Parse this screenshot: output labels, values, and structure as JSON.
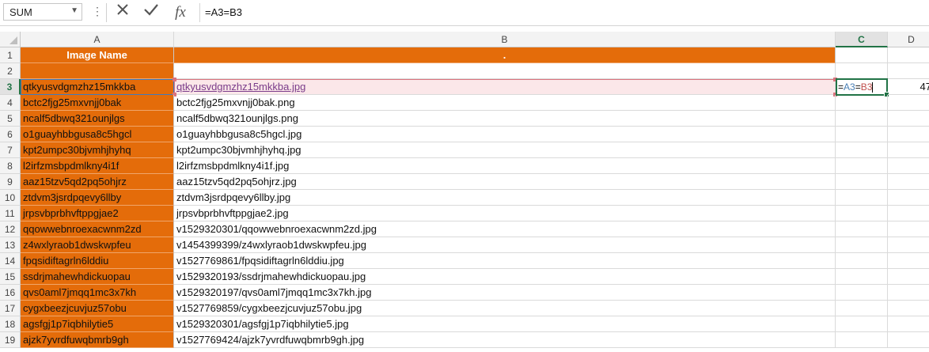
{
  "formula_bar": {
    "name_box": "SUM",
    "formula": "=A3=B3",
    "cancel_icon": "x-icon",
    "enter_icon": "check-icon",
    "function_label": "fx"
  },
  "columns": [
    "A",
    "B",
    "C",
    "D"
  ],
  "selected_column": "C",
  "selected_row": "3",
  "rows": [
    {
      "num": "1",
      "a": "Image Name",
      "b": ".",
      "c": "",
      "d": ""
    },
    {
      "num": "2",
      "a": "",
      "b": "",
      "c": "",
      "d": ""
    },
    {
      "num": "3",
      "a": "qtkyusvdgmzhz15mkkba",
      "b": "qtkyusvdgmzhz15mkkba.jpg",
      "c": "",
      "d": "47"
    },
    {
      "num": "4",
      "a": "bctc2fjg25mxvnjj0bak",
      "b": "bctc2fjg25mxvnjj0bak.png",
      "c": "",
      "d": ""
    },
    {
      "num": "5",
      "a": "ncalf5dbwq321ounjlgs",
      "b": "ncalf5dbwq321ounjlgs.png",
      "c": "",
      "d": ""
    },
    {
      "num": "6",
      "a": "o1guayhbbgusa8c5hgcl",
      "b": "o1guayhbbgusa8c5hgcl.jpg",
      "c": "",
      "d": ""
    },
    {
      "num": "7",
      "a": "kpt2umpc30bjvmhjhyhq",
      "b": "kpt2umpc30bjvmhjhyhq.jpg",
      "c": "",
      "d": ""
    },
    {
      "num": "8",
      "a": "l2irfzmsbpdmlkny4i1f",
      "b": "l2irfzmsbpdmlkny4i1f.jpg",
      "c": "",
      "d": ""
    },
    {
      "num": "9",
      "a": "aaz15tzv5qd2pq5ohjrz",
      "b": "aaz15tzv5qd2pq5ohjrz.jpg",
      "c": "",
      "d": ""
    },
    {
      "num": "10",
      "a": "ztdvm3jsrdpqevy6llby",
      "b": "ztdvm3jsrdpqevy6llby.jpg",
      "c": "",
      "d": ""
    },
    {
      "num": "11",
      "a": "jrpsvbprbhvftppgjae2",
      "b": "jrpsvbprbhvftppgjae2.jpg",
      "c": "",
      "d": ""
    },
    {
      "num": "12",
      "a": "qqowwebnroexacwnm2zd",
      "b": "v1529320301/qqowwebnroexacwnm2zd.jpg",
      "c": "",
      "d": ""
    },
    {
      "num": "13",
      "a": "z4wxlyraob1dwskwpfeu",
      "b": "v1454399399/z4wxlyraob1dwskwpfeu.jpg",
      "c": "",
      "d": ""
    },
    {
      "num": "14",
      "a": "fpqsidiftagrln6lddiu",
      "b": "v1527769861/fpqsidiftagrln6lddiu.jpg",
      "c": "",
      "d": ""
    },
    {
      "num": "15",
      "a": "ssdrjmahewhdickuopau",
      "b": "v1529320193/ssdrjmahewhdickuopau.jpg",
      "c": "",
      "d": ""
    },
    {
      "num": "16",
      "a": "qvs0aml7jmqq1mc3x7kh",
      "b": "v1529320197/qvs0aml7jmqq1mc3x7kh.jpg",
      "c": "",
      "d": ""
    },
    {
      "num": "17",
      "a": "cygxbeezjcuvjuz57obu",
      "b": "v1527769859/cygxbeezjcuvjuz57obu.jpg",
      "c": "",
      "d": ""
    },
    {
      "num": "18",
      "a": "agsfgj1p7iqbhilytie5",
      "b": "v1529320301/agsfgj1p7iqbhilytie5.jpg",
      "c": "",
      "d": ""
    },
    {
      "num": "19",
      "a": "ajzk7yvrdfuwqbmrb9gh",
      "b": "v1527769424/ajzk7yvrdfuwqbmrb9gh.jpg",
      "c": "",
      "d": ""
    }
  ],
  "active_cell": {
    "eq1": "=",
    "ref_a": "A3",
    "eq2": "=",
    "ref_b": "B3"
  },
  "colors": {
    "header_fill": "#e46c0a",
    "selection": "#217346",
    "ref_a": "#4a7fb5",
    "ref_b": "#c0504d"
  }
}
